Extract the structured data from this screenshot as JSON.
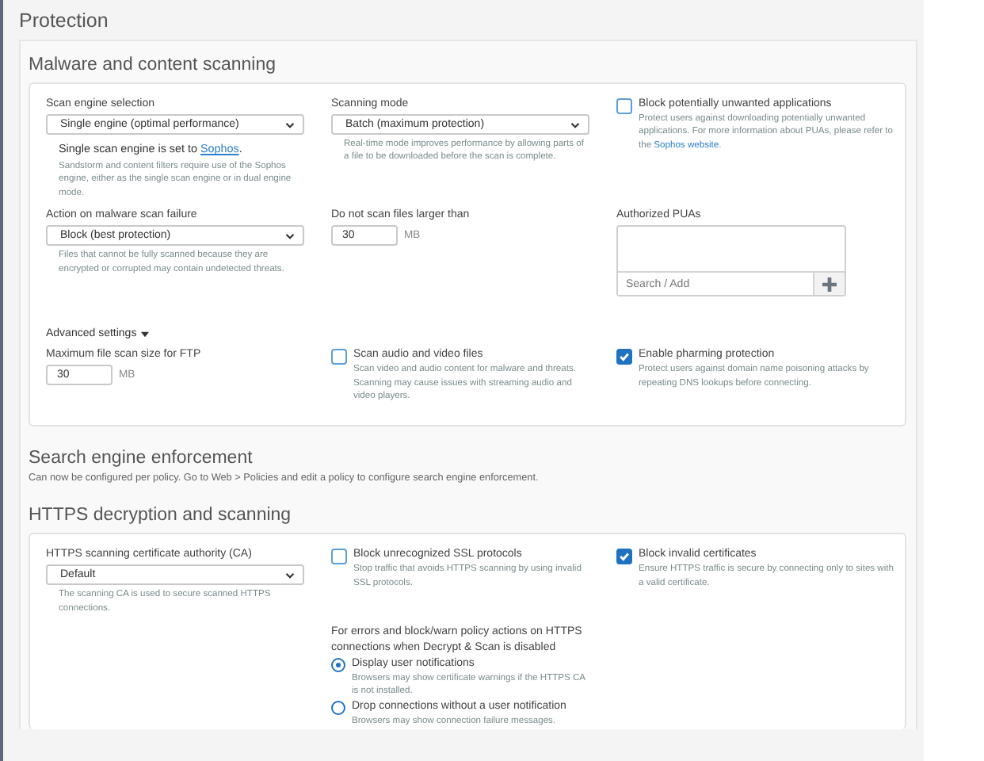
{
  "page_title": "Protection",
  "malware": {
    "title": "Malware and content scanning",
    "rows": [
      {
        "cells": [
          {
            "kind": "select",
            "label": "Scan engine selection",
            "value": "Single engine (optimal performance)",
            "note": "Single scan engine is set to ",
            "note_link": "Sophos",
            "note_end": ".",
            "help": "Sandstorm and content filters require use of the Sophos engine, either as the single scan engine or in dual engine mode."
          },
          {
            "kind": "select",
            "label": "Scanning mode",
            "value": "Batch (maximum protection)",
            "help": "Real-time mode improves performance by allowing parts of a file to be downloaded before the scan is complete."
          },
          {
            "kind": "checkbox",
            "label": "Block potentially unwanted applications",
            "checked": false,
            "help": "Protect users against downloading potentially unwanted applications. For more information about PUAs, please refer to the ",
            "help_link": "Sophos website",
            "help_end": "."
          }
        ]
      },
      {
        "cells": [
          {
            "kind": "select",
            "label": "Action on malware scan failure",
            "value": "Block (best protection)",
            "help": "Files that cannot be fully scanned because they are encrypted or corrupted may contain undetected threats."
          },
          {
            "kind": "number",
            "label": "Do not scan files larger than",
            "value": "30",
            "unit": "MB"
          },
          {
            "kind": "list",
            "label": "Authorized PUAs",
            "placeholder": "Search / Add"
          }
        ]
      }
    ],
    "advanced": {
      "label": "Advanced settings",
      "expanded": true
    },
    "advanced_rows": [
      {
        "cells": [
          {
            "kind": "number",
            "label": "Maximum file scan size for FTP",
            "value": "30",
            "unit": "MB"
          },
          {
            "kind": "checkbox",
            "label": "Scan audio and video files",
            "checked": false,
            "help": "Scan video and audio content for malware and threats. Scanning may cause issues with streaming audio and video players."
          },
          {
            "kind": "checkbox",
            "label": "Enable pharming protection",
            "checked": true,
            "help": "Protect users against domain name poisoning attacks by repeating DNS lookups before connecting."
          }
        ]
      }
    ]
  },
  "search_engine": {
    "title": "Search engine enforcement",
    "text": "Can now be configured per policy. Go to Web > Policies and edit a policy to configure search engine enforcement."
  },
  "https": {
    "title": "HTTPS decryption and scanning",
    "rows": [
      {
        "cells": [
          {
            "kind": "select",
            "label": "HTTPS scanning certificate authority (CA)",
            "value": "Default",
            "help": "The scanning CA is used to secure scanned HTTPS connections."
          },
          {
            "kind": "checkbox",
            "label": "Block unrecognized SSL protocols",
            "checked": false,
            "help": "Stop traffic that avoids HTTPS scanning by using invalid SSL protocols."
          },
          {
            "kind": "checkbox",
            "label": "Block invalid certificates",
            "checked": true,
            "help": "Ensure HTTPS traffic is secure by connecting only to sites with a valid certificate."
          }
        ]
      },
      {
        "cells": [
          {
            "kind": "empty"
          },
          {
            "kind": "radio_group",
            "label": "For errors and block/warn policy actions on HTTPS connections when Decrypt & Scan is disabled",
            "options": [
              {
                "label": "Display user notifications",
                "selected": true,
                "help": "Browsers may show certificate warnings if the HTTPS CA is not installed."
              },
              {
                "label": "Drop connections without a user notification",
                "selected": false,
                "help": "Browsers may show connection failure messages."
              }
            ]
          },
          {
            "kind": "empty"
          }
        ]
      }
    ]
  }
}
